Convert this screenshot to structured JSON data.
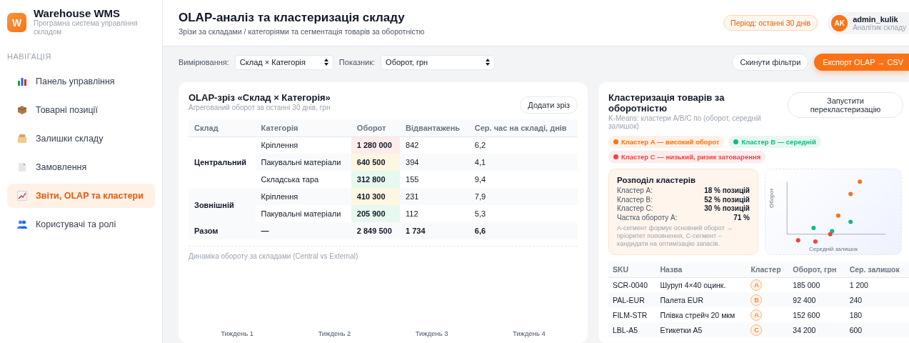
{
  "brand": {
    "logo_letter": "W",
    "name": "Warehouse WMS",
    "subtitle": "Програмна система управління складом"
  },
  "sidebar": {
    "section": "НАВІГАЦІЯ",
    "items": [
      {
        "label": "Панель управління",
        "selected": false
      },
      {
        "label": "Товарні позиції",
        "selected": false
      },
      {
        "label": "Залишки складу",
        "selected": false
      },
      {
        "label": "Замовлення",
        "selected": false
      },
      {
        "label": "Звіти, OLAP та кластери",
        "selected": true
      },
      {
        "label": "Користувачі та ролі",
        "selected": false
      }
    ]
  },
  "header": {
    "title": "OLAP-аналіз та кластеризація складу",
    "subtitle": "Зрізи за складами / категоріями та сегментація товарів за оборотністю",
    "period": "Період: останні 30 днів",
    "user": {
      "initials": "AK",
      "name": "admin_kulik",
      "role": "Аналітик складу"
    }
  },
  "toolbar": {
    "dimension_label": "Вимірювання:",
    "dimension_value": "Склад × Категорія",
    "metric_label": "Показник:",
    "metric_value": "Оборот, грн",
    "reset_button": "Скинути фільтри",
    "export_button": "Експорт OLAP → CSV"
  },
  "olap": {
    "title": "OLAP-зріз «Склад × Категорія»",
    "subtitle": "Агрегований оборот за останні 30 днів, грн",
    "add_button": "Додати зріз",
    "columns": [
      "Склад",
      "Категорія",
      "Оборот",
      "Відвантажень",
      "Сер. час на складі, днів"
    ],
    "groups": [
      {
        "warehouse": "Центральний",
        "rows": [
          {
            "category": "Кріплення",
            "turnover": "1 280 000",
            "color": "#fdeceb",
            "shipments": "842",
            "days": "6,2"
          },
          {
            "category": "Пакувальні матеріали",
            "turnover": "640 500",
            "color": "#fdf6e2",
            "shipments": "394",
            "days": "4,1"
          },
          {
            "category": "Складська тара",
            "turnover": "312 800",
            "color": "#e7f8ef",
            "shipments": "155",
            "days": "9,4"
          }
        ]
      },
      {
        "warehouse": "Зовнішній",
        "rows": [
          {
            "category": "Кріплення",
            "turnover": "410 300",
            "color": "#fdf6e2",
            "shipments": "231",
            "days": "7,9"
          },
          {
            "category": "Пакувальні матеріали",
            "turnover": "205 900",
            "color": "#e7f8ef",
            "shipments": "112",
            "days": "5,3"
          }
        ]
      }
    ],
    "total": {
      "label": "Разом",
      "category": "—",
      "turnover": "2 849 500",
      "shipments": "1 734",
      "days": "6,6"
    },
    "trend": {
      "caption": "Динаміка обороту за складами (Central vs External)",
      "weeks": [
        "Тиждень 1",
        "Тиждень 2",
        "Тиждень 3",
        "Тиждень 4"
      ]
    }
  },
  "clusters": {
    "title": "Кластеризація товарів за оборотністю",
    "subtitle": "K-Means: кластери A/B/C по (оборот, середній залишок)",
    "run_button": "Запустити перекластеризацію",
    "legend": [
      {
        "label": "Кластер A — високий оборот",
        "color": "#f97316"
      },
      {
        "label": "Кластер B — середній",
        "color": "#10b981"
      },
      {
        "label": "Кластер C — низький, ризик затоварення",
        "color": "#ef4444"
      }
    ],
    "distribution": {
      "title": "Розподіл кластерів",
      "rows": [
        {
          "label": "Кластер A:",
          "value": "18 % позицій"
        },
        {
          "label": "Кластер B:",
          "value": "52 % позицій"
        },
        {
          "label": "Кластер C:",
          "value": "30 % позицій"
        },
        {
          "label": "Частка обороту A:",
          "value": "71 %"
        }
      ],
      "note": "A-сегмент формує основний оборот → пріоритет поповнення, C-сегмент – кандидати на оптимізацію запасів."
    },
    "scatter": {
      "ylabel": "Оборот",
      "xlabel": "Середній залишок"
    },
    "columns": [
      "SKU",
      "Назва",
      "Кластер",
      "Оборот, грн",
      "Сер. залишок"
    ],
    "rows": [
      {
        "sku": "SCR-0040",
        "name": "Шуруп 4×40 оцинк.",
        "cluster": "A",
        "turnover": "185 000",
        "stock": "1 200"
      },
      {
        "sku": "PAL-EUR",
        "name": "Палета EUR",
        "cluster": "B",
        "turnover": "92 400",
        "stock": "240"
      },
      {
        "sku": "FILM-STR",
        "name": "Плівка стрейч 20 мкм",
        "cluster": "A",
        "turnover": "152 600",
        "stock": "180"
      },
      {
        "sku": "LBL-A5",
        "name": "Етикетки A5",
        "cluster": "C",
        "turnover": "34 200",
        "stock": "600"
      }
    ]
  }
}
